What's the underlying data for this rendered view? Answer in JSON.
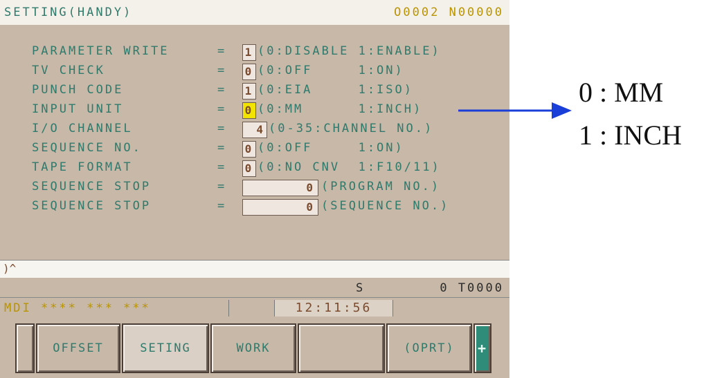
{
  "screen": {
    "title": "SETTING(HANDY)",
    "program_info": "O0002 N00000",
    "rows": [
      {
        "label": "PARAMETER WRITE",
        "sep": "=",
        "value": "1",
        "desc": "(0:DISABLE 1:ENABLE)",
        "highlight": false
      },
      {
        "label": "TV CHECK",
        "sep": "=",
        "value": "0",
        "desc": "(0:OFF     1:ON)",
        "highlight": false
      },
      {
        "label": "PUNCH CODE",
        "sep": "=",
        "value": "1",
        "desc": "(0:EIA     1:ISO)",
        "highlight": false
      },
      {
        "label": "INPUT UNIT",
        "sep": "=",
        "value": "0",
        "desc": "(0:MM      1:INCH)",
        "highlight": true
      },
      {
        "label": "I/O CHANNEL",
        "sep": "=",
        "value": "4",
        "desc": "(0-35:CHANNEL NO.)",
        "highlight": false
      },
      {
        "label": "SEQUENCE NO.",
        "sep": "=",
        "value": "0",
        "desc": "(0:OFF     1:ON)",
        "highlight": false
      },
      {
        "label": "TAPE FORMAT",
        "sep": "=",
        "value": "0",
        "desc": "(0:NO CNV  1:F10/11)",
        "highlight": false
      },
      {
        "label": "SEQUENCE STOP",
        "sep": "=",
        "value": "0",
        "desc": "(PROGRAM NO.)",
        "highlight": false
      },
      {
        "label": "SEQUENCE STOP",
        "sep": "=",
        "value": "0",
        "desc": "(SEQUENCE NO.)",
        "highlight": false
      }
    ],
    "input_prompt": ")^",
    "spindle": "S",
    "tool": "0 T0000",
    "mode": "MDI **** *** ***",
    "time": "12:11:56",
    "softkeys": [
      "",
      "OFFSET",
      "SETING",
      "WORK",
      "",
      "(OPRT)",
      "+"
    ]
  },
  "annotation": {
    "line1": "0 : MM",
    "line2": "1 : INCH",
    "arrow_color": "#1a3fd9"
  }
}
